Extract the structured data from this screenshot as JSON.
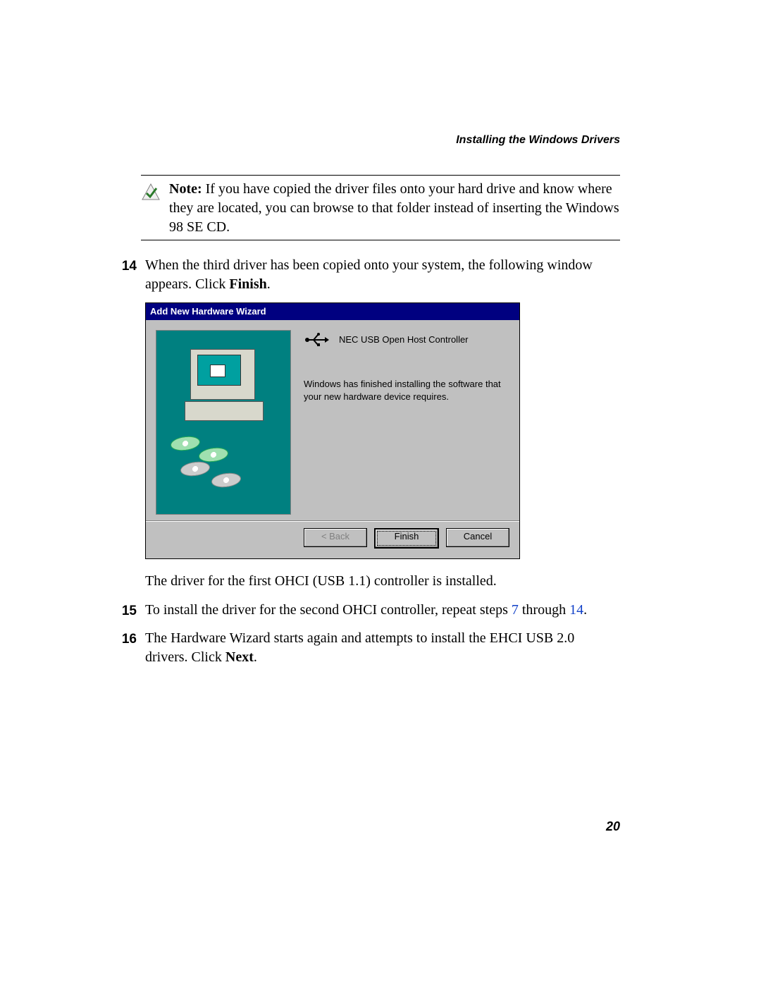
{
  "header": {
    "running_head": "Installing the Windows Drivers"
  },
  "note": {
    "label": "Note:",
    "text": " If you have copied the driver files onto your hard drive and know where they are located, you can browse to that folder instead of inserting the Windows 98 SE CD."
  },
  "steps": {
    "s14": {
      "num": "14",
      "text_a": "When the third driver has been copied onto your system, the following window appears. Click ",
      "bold": "Finish",
      "text_b": "."
    },
    "after14": "The driver for the first OHCI (USB 1.1) controller is installed.",
    "s15": {
      "num": "15",
      "text_a": "To install the driver for the second OHCI controller, repeat steps ",
      "link7": "7",
      "mid": " through ",
      "link14": "14",
      "text_b": "."
    },
    "s16": {
      "num": "16",
      "text_a": "The Hardware Wizard starts again and attempts to install the EHCI USB 2.0 drivers. Click ",
      "bold": "Next",
      "text_b": "."
    }
  },
  "wizard": {
    "title": "Add New Hardware Wizard",
    "device": "NEC USB Open Host Controller",
    "message": "Windows has finished installing the software that your new hardware device requires.",
    "buttons": {
      "back": "< Back",
      "finish": "Finish",
      "cancel": "Cancel"
    }
  },
  "page_number": "20"
}
